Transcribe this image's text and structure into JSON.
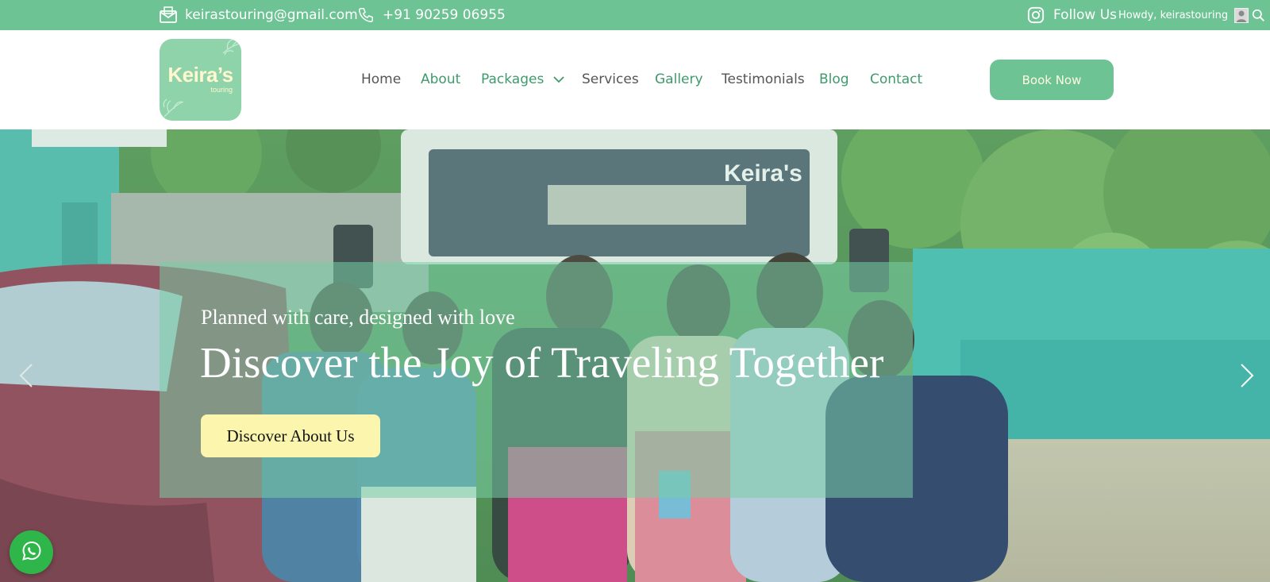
{
  "topbar": {
    "email": "keirastouring@gmail.com",
    "phone": "+91 90259 06955",
    "follow_label": "Follow Us",
    "howdy": "Howdy, keirastouring",
    "icons": [
      "mail-icon",
      "phone-icon",
      "instagram-icon",
      "avatar",
      "search-icon"
    ]
  },
  "logo": {
    "title": "Keira’s",
    "subtitle": "touring"
  },
  "nav": {
    "items": [
      {
        "label": "Home"
      },
      {
        "label": "About"
      },
      {
        "label": "Packages"
      },
      {
        "label": "Services"
      },
      {
        "label": "Gallery"
      },
      {
        "label": "Testimonials"
      },
      {
        "label": "Blog"
      },
      {
        "label": "Contact"
      }
    ],
    "book_label": "Book Now"
  },
  "hero": {
    "subtitle": "Planned with care, designed with love",
    "title": "Discover the Joy of Traveling Together",
    "cta_label": "Discover About Us",
    "van_label": "Keira's"
  },
  "colors": {
    "brand_green": "#6dc393",
    "nav_green": "#3f9a6c",
    "cta_yellow": "#fbf5ad",
    "whatsapp_green": "#2fb64a"
  }
}
